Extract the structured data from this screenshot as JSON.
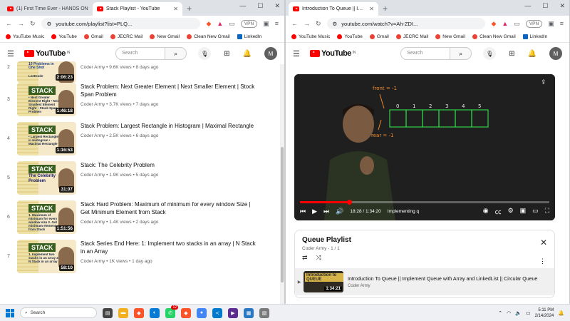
{
  "left_window": {
    "tabs": [
      {
        "title": "(1) First Time Ever - HANDS ON",
        "active": false
      },
      {
        "title": "Stack Playlist - YouTube",
        "active": true
      }
    ],
    "url": "youtube.com/playlist?list=PLQ...",
    "bookmarks": [
      "YouTube Music",
      "YouTube",
      "Gmail",
      "JECRC Mail",
      "New Gmail",
      "Clean New Gmail",
      "LinkedIn"
    ],
    "search_placeholder": "Search",
    "country_code": "IN",
    "logo_text": "YouTube",
    "avatar_letter": "M",
    "playlist": [
      {
        "index": "2",
        "title": "",
        "channel": "Coder Army",
        "info": "9.6K views • 8 days ago",
        "duration": "2:06:23",
        "thumb_title": "10 Problems in One Shot",
        "thumb_sub": "LeetCode"
      },
      {
        "index": "3",
        "title": "Stack Problem: Next Greater Element | Next Smaller Element | Stock Span Problem",
        "channel": "Coder Army",
        "info": "3.7K views • 7 days ago",
        "duration": "1:46:18",
        "thumb_title": "STACK",
        "thumb_sub": "• Next Greater Element Right • Next Smallest Element Right • Stock Span Problem"
      },
      {
        "index": "4",
        "title": "Stack Problem: Largest Rectangle in Histogram | Maximal Rectangle",
        "channel": "Coder Army",
        "info": "2.5K views • 6 days ago",
        "duration": "1:16:53",
        "thumb_title": "STACK",
        "thumb_sub": "• Largest Rectangle in Histogram • Maximal Rectangle"
      },
      {
        "index": "5",
        "title": "Stack: The Celebrity Problem",
        "channel": "Coder Army",
        "info": "1.9K views • 5 days ago",
        "duration": "31:07",
        "thumb_title": "STACK",
        "thumb_sub": "The Celebrity Problem"
      },
      {
        "index": "6",
        "title": "Stack Hard Problem: Maximum of minimum for every window Size | Get Minimum Element from Stack",
        "channel": "Coder Army",
        "info": "1.4K views • 2 days ago",
        "duration": "1:51:56",
        "thumb_title": "STACK",
        "thumb_sub": "1. Maximum of minimum for every window size 2. Get minimum element from Stack"
      },
      {
        "index": "7",
        "title": "Stack Series End Here: 1: Implement two stacks in an array | N Stack in an Array",
        "channel": "Coder Army",
        "info": "1K views • 1 day ago",
        "duration": "58:10",
        "thumb_title": "STACK",
        "thumb_sub": "1. Implement two stacks in an array 2. N Stack in an array"
      }
    ]
  },
  "right_window": {
    "tabs": [
      {
        "title": "Introduction To Queue || Implem",
        "active": true
      }
    ],
    "url": "youtube.com/watch?v=Ah-ZDI...",
    "bookmarks": [
      "YouTube Music",
      "YouTube",
      "Gmail",
      "JECRC Mail",
      "New Gmail",
      "Clean New Gmail",
      "LinkedIn"
    ],
    "search_placeholder": "Search",
    "country_code": "IN",
    "logo_text": "YouTube",
    "avatar_letter": "M",
    "player": {
      "time": "18:28 / 1:34:20",
      "chapter": "Implementing q",
      "progress_fraction": 0.196,
      "board": {
        "front_label": "front = -1",
        "rear_label": "rear = -1",
        "cells": [
          "0",
          "1",
          "2",
          "3",
          "4",
          "5"
        ]
      }
    },
    "queue_panel": {
      "title": "Queue Playlist",
      "subtitle": "Coder Army - 1 / 1",
      "item": {
        "title": "Introduction To Queue || Implement Queue with Array and LinkedList || Circular Queue",
        "channel": "Coder Army",
        "duration": "1:34:21",
        "thumb_tag": "Introduction to QUEUE"
      }
    }
  },
  "taskbar": {
    "search_placeholder": "Search",
    "time": "5:11 PM",
    "date": "2/14/2024",
    "badge": "12"
  },
  "colors": {
    "youtube_red": "#ff0000",
    "board_green": "#2fd14b",
    "board_orange": "#f08a2c",
    "progress_red": "#ff0000",
    "thumb_green": "#3a5f1f"
  }
}
